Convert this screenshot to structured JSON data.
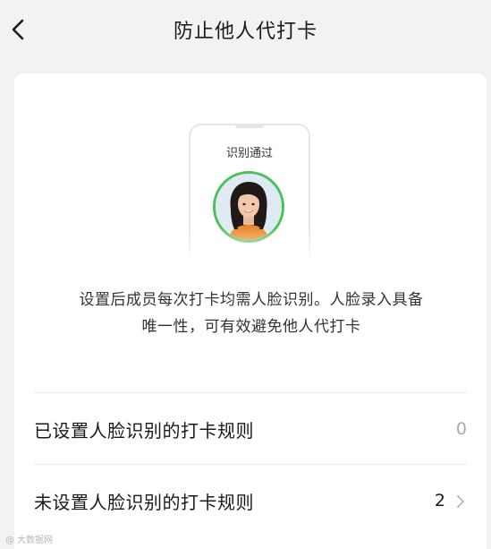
{
  "nav": {
    "title": "防止他人代打卡",
    "back_icon": "chevron-left-icon"
  },
  "illustration": {
    "status_text": "识别通过",
    "accent_color": "#4cc05a"
  },
  "description": {
    "line1": "设置后成员每次打卡均需人脸识别。人脸录入具备",
    "line2": "唯一性，可有效避免他人代打卡"
  },
  "rules": [
    {
      "label": "已设置人脸识别的打卡规则",
      "count": "0"
    },
    {
      "label": "未设置人脸识别的打卡规则",
      "count": "2",
      "icon": "chevron-right-icon"
    }
  ],
  "watermark": "@ 大数据网"
}
